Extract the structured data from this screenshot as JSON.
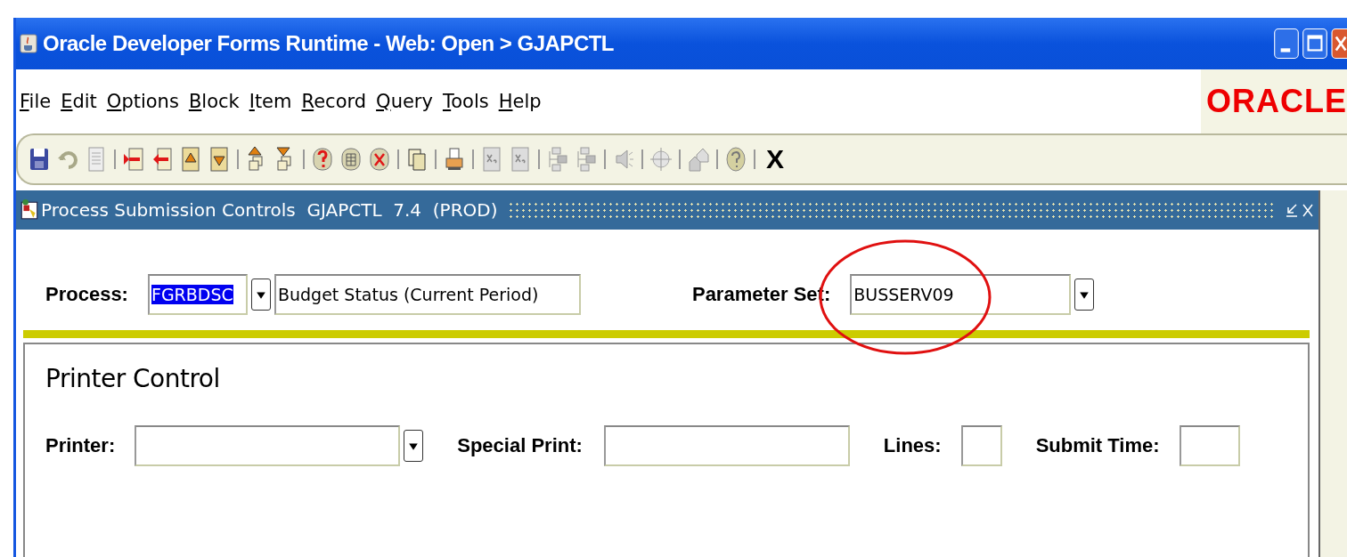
{
  "window": {
    "title": "Oracle Developer Forms Runtime - Web:  Open > GJAPCTL"
  },
  "menu": [
    {
      "label": "File"
    },
    {
      "label": "Edit"
    },
    {
      "label": "Options"
    },
    {
      "label": "Block"
    },
    {
      "label": "Item"
    },
    {
      "label": "Record"
    },
    {
      "label": "Query"
    },
    {
      "label": "Tools"
    },
    {
      "label": "Help"
    }
  ],
  "logo": "ORACLE",
  "toolbar": {
    "exit_label": "X"
  },
  "form": {
    "title": "Process Submission Controls  GJAPCTL  7.4  (PROD)",
    "process": {
      "label": "Process:",
      "code": "FGRBDSC",
      "code_selected": true,
      "description": "Budget Status (Current Period)"
    },
    "parameter_set": {
      "label": "Parameter Set:",
      "value": "BUSSERV09",
      "circled": true
    },
    "printer_control": {
      "title": "Printer Control",
      "fields": [
        {
          "label": "Printer:",
          "kind": "dropdown"
        },
        {
          "label": "Special Print:",
          "kind": "text"
        },
        {
          "label": "Lines:",
          "kind": "short"
        },
        {
          "label": "Submit Time:",
          "kind": "short"
        }
      ]
    }
  }
}
